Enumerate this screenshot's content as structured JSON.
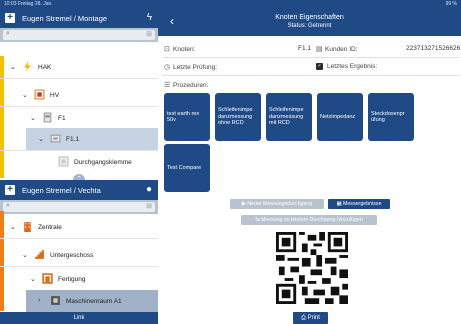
{
  "status_bar": {
    "left": "10:03 Freitag 28. Jan.",
    "right": "99 %"
  },
  "left_panel": {
    "header1": {
      "title": "Eugen Stremel / Montage",
      "icon": "flash-icon"
    },
    "tree1": [
      {
        "label": "HAK"
      },
      {
        "label": "HV"
      },
      {
        "label": "F1"
      },
      {
        "label": "F1.1"
      },
      {
        "label": "Durchgangsklemme"
      }
    ],
    "header2": {
      "title": "Eugen Stremel / Vechta",
      "icon": "location-icon"
    },
    "tree2": [
      {
        "label": "Zentrale"
      },
      {
        "label": "Untergeschoss"
      },
      {
        "label": "Fertigung"
      },
      {
        "label": "Maschinenraum A1"
      }
    ],
    "link_label": "Link"
  },
  "right_panel": {
    "title": "Knoten Eigenschaften",
    "subtitle": "Status: Getrennt",
    "fields": {
      "knoten_label": "Knoten:",
      "knoten_value": "F1.1",
      "kunden_label": "Kunden ID:",
      "kunden_value": "223713271526626",
      "pruefung_label": "Letzte Prüfung:",
      "ergebnis_label": "Letztes Ergebnis:",
      "prozeduren_label": "Prozeduren:"
    },
    "procedures": [
      "test earth res 50v",
      "Schleifenimpe danzmessung ohne RCD",
      "Schleifenimpe danzmessung mit RCD",
      "Netzimpedanz",
      "Steckdosenpr üfung",
      "Test Compare"
    ],
    "buttons": {
      "new_run": "Neuer Messungsdurchgang",
      "results": "Messergebnisse",
      "add_to_last": "Messung zu letztem Durchgang hinzufügen",
      "print": "Print"
    }
  }
}
